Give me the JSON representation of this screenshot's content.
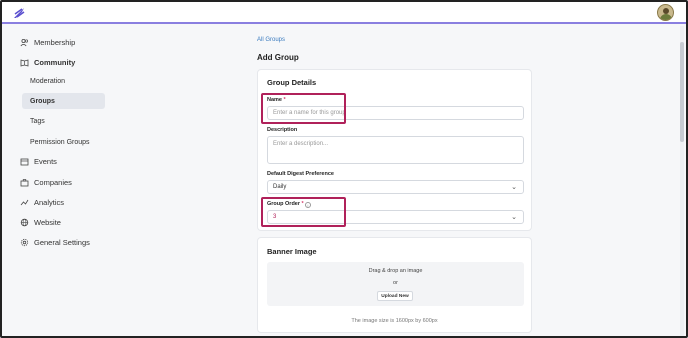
{
  "app": {
    "logo_icon": "feather-logo-icon",
    "accent": "#8a7fe0",
    "highlight": "#b0215a"
  },
  "sidebar": {
    "membership": "Membership",
    "community": "Community",
    "moderation": "Moderation",
    "groups": "Groups",
    "tags": "Tags",
    "permission_groups": "Permission Groups",
    "events": "Events",
    "companies": "Companies",
    "analytics": "Analytics",
    "website": "Website",
    "general_settings": "General Settings"
  },
  "main": {
    "breadcrumb": "All Groups",
    "title": "Add Group",
    "details_card": {
      "title": "Group Details",
      "name_label": "Name",
      "required_mark": "*",
      "name_placeholder": "Enter a name for this group",
      "description_label": "Description",
      "description_placeholder": "Enter a description...",
      "digest_label": "Default Digest Preference",
      "digest_value": "Daily",
      "order_label": "Group Order",
      "order_value": "3"
    },
    "banner_card": {
      "title": "Banner Image",
      "drag_text": "Drag & drop an image",
      "or_text": "or",
      "upload_label": "Upload New",
      "size_note": "The image size is 1600px by 600px"
    }
  }
}
